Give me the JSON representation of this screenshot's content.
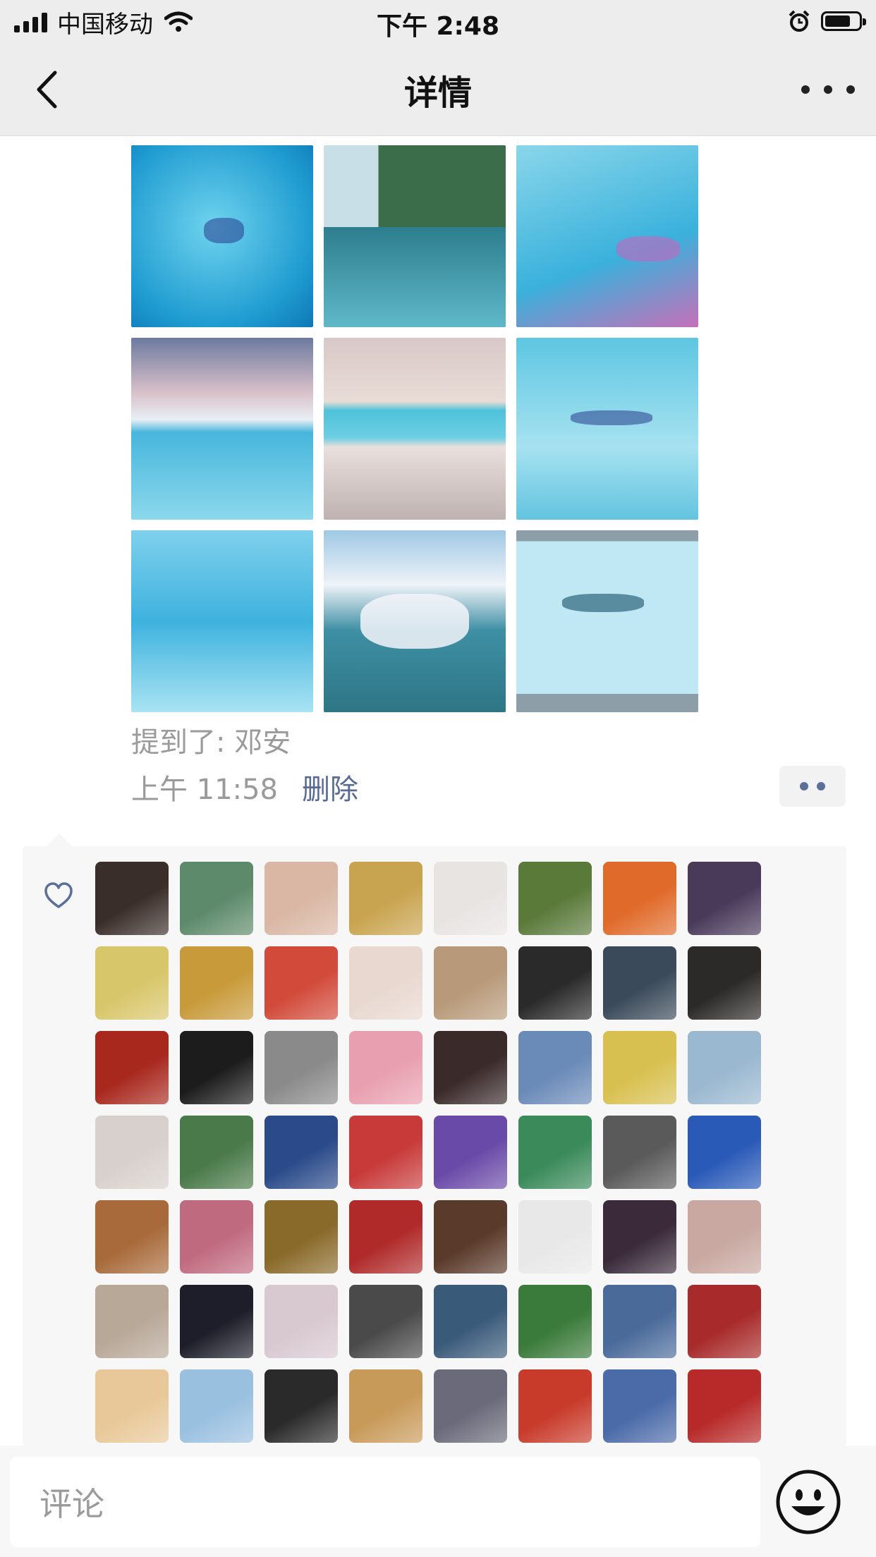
{
  "status_bar": {
    "carrier": "中国移动",
    "time": "下午 2:48",
    "battery_level": 0.75
  },
  "nav": {
    "title": "详情",
    "back_icon": "chevron-left-icon",
    "more_icon": "more-horizontal-icon"
  },
  "post": {
    "photo_count": 9,
    "mention": "提到了: 邓安",
    "time": "上午 11:58",
    "delete_label": "删除",
    "action_icon": "dots-icon"
  },
  "likes": {
    "icon": "heart-icon",
    "avatar_count": 56,
    "colors": [
      "#3a2e2a",
      "#5d8a6a",
      "#d9b7a4",
      "#c9a450",
      "#e8e4e2",
      "#5a7a3a",
      "#e06a2a",
      "#4a3a5a",
      "#d8c66a",
      "#c89a3a",
      "#d24a3a",
      "#e8d8d0",
      "#b89a7a",
      "#2a2a2a",
      "#3a4a5a",
      "#2c2a28",
      "#a8281e",
      "#1c1c1c",
      "#8a8a8a",
      "#e8a0b0",
      "#3a2a2a",
      "#6a8ab8",
      "#d8c050",
      "#9ab8d0",
      "#d8d0cc",
      "#4a7a4a",
      "#2a4a8a",
      "#c83a3a",
      "#6a4aa8",
      "#3a8a5a",
      "#5a5a5a",
      "#2a5ab8",
      "#a86a3a",
      "#c06a80",
      "#8a6a2a",
      "#b02a2a",
      "#5a3a2a",
      "#e8e8e8",
      "#3a2a3a",
      "#c8a8a0",
      "#b8a898",
      "#1e1e2a",
      "#d8c8d0",
      "#4a4a4a",
      "#3a5a7a",
      "#3a7a3a",
      "#4a6a9a",
      "#a82a2a",
      "#e8c898",
      "#9ac0e0",
      "#2a2a2a",
      "#c89a5a",
      "#6a6a7a",
      "#c83a2a",
      "#4a6aa8",
      "#b82a2a"
    ]
  },
  "comment": {
    "placeholder": "评论",
    "emoji_icon": "smiley-icon"
  }
}
